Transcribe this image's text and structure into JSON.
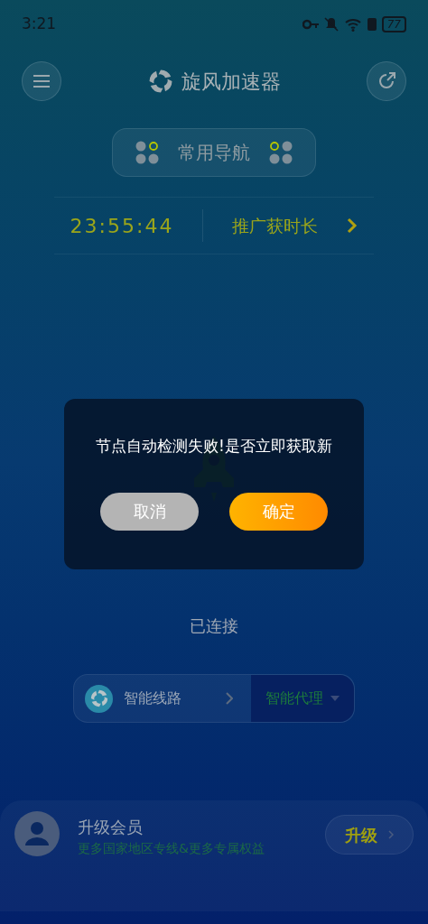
{
  "status_bar": {
    "time": "3:21",
    "battery": "77"
  },
  "header": {
    "title": "旋风加速器"
  },
  "nav_button": {
    "label": "常用导航"
  },
  "timer": {
    "time": "23:55:44",
    "link": "推广获时长"
  },
  "connection": {
    "status": "已连接"
  },
  "route": {
    "line": "智能线路",
    "mode": "智能代理"
  },
  "dialog": {
    "message": "节点自动检测失败!是否立即获取新",
    "buttons": [
      {
        "label": "取消",
        "kind": "cancel"
      },
      {
        "label": "确定",
        "kind": "confirm"
      }
    ]
  },
  "member": {
    "title": "升级会员",
    "subtitle": "更多国家地区专线&更多专属权益",
    "button": "升级"
  }
}
